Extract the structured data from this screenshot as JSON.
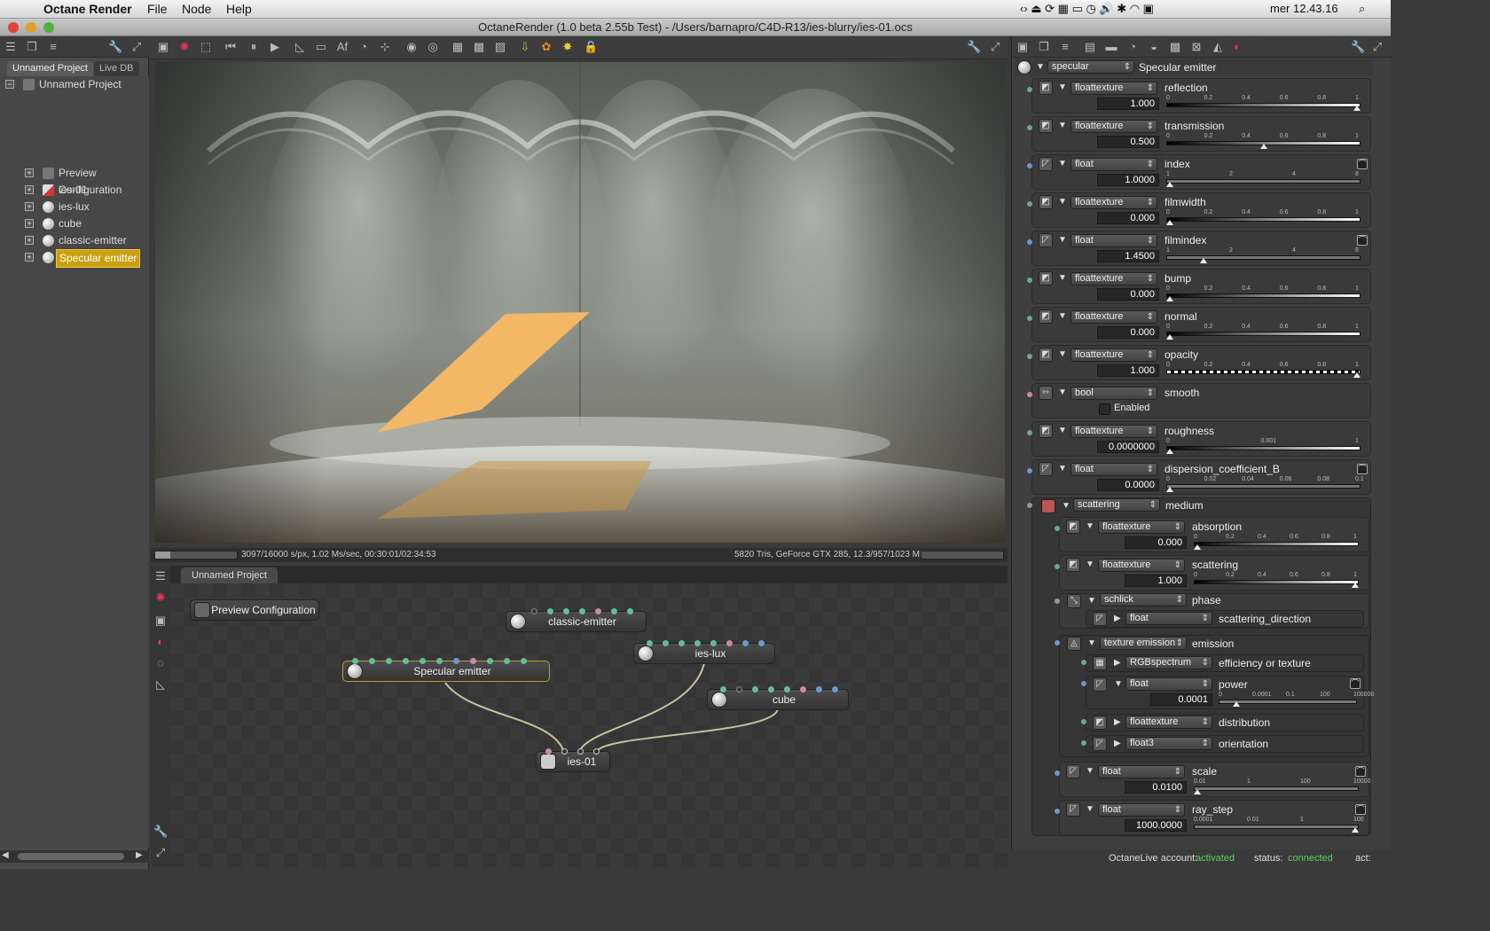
{
  "menubar": {
    "app": "Octane Render",
    "items": [
      "File",
      "Node",
      "Help"
    ],
    "clock": "mer 12.43.16"
  },
  "window": {
    "title": "OctaneRender (1.0 beta 2.55b Test) - /Users/barnapro/C4D-R13/ies-blurry/ies-01.ocs"
  },
  "left": {
    "tabs": [
      "Unnamed Project",
      "Live DB"
    ],
    "root": "Unnamed Project",
    "items": [
      "Preview Configuration",
      "ies-01",
      "ies-lux",
      "cube",
      "classic-emitter",
      "Specular emitter"
    ]
  },
  "viewport": {
    "status_left": "3097/16000 s/px, 1.02 Ms/sec, 00:30:01/02:34:53",
    "status_right": "5820 Tris, GeForce GTX 285, 12.3/957/1023 MB"
  },
  "nodeeditor": {
    "tab": "Unnamed Project",
    "preview": "Preview Configuration",
    "nodes": {
      "classic": "classic-emitter",
      "ieslux": "ies-lux",
      "specular": "Specular emitter",
      "cube": "cube",
      "ies01": "ies-01"
    }
  },
  "inspector": {
    "header_type": "specular",
    "header_name": "Specular emitter",
    "params": [
      {
        "type": "floattexture",
        "name": "reflection",
        "value": "1.000",
        "ticks": [
          "0",
          "0.2",
          "0.4",
          "0.6",
          "0.8",
          "1"
        ]
      },
      {
        "type": "floattexture",
        "name": "transmission",
        "value": "0.500",
        "ticks": [
          "0",
          "0.2",
          "0.4",
          "0.6",
          "0.8",
          "1"
        ]
      },
      {
        "type": "float",
        "name": "index",
        "value": "1.0000",
        "ticks": [
          "1",
          "2",
          "4",
          "8"
        ]
      },
      {
        "type": "floattexture",
        "name": "filmwidth",
        "value": "0.000",
        "ticks": [
          "0",
          "0.2",
          "0.4",
          "0.6",
          "0.8",
          "1"
        ]
      },
      {
        "type": "float",
        "name": "filmindex",
        "value": "1.4500",
        "ticks": [
          "1",
          "2",
          "4",
          "8"
        ]
      },
      {
        "type": "floattexture",
        "name": "bump",
        "value": "0.000",
        "ticks": [
          "0",
          "0.2",
          "0.4",
          "0.6",
          "0.8",
          "1"
        ]
      },
      {
        "type": "floattexture",
        "name": "normal",
        "value": "0.000",
        "ticks": [
          "0",
          "0.2",
          "0.4",
          "0.6",
          "0.8",
          "1"
        ]
      },
      {
        "type": "floattexture",
        "name": "opacity",
        "value": "1.000",
        "ticks": [
          "0",
          "0.2",
          "0.4",
          "0.6",
          "0.8",
          "1"
        ]
      },
      {
        "type": "bool",
        "name": "smooth",
        "value": "Enabled"
      },
      {
        "type": "floattexture",
        "name": "roughness",
        "value": "0.0000000",
        "ticks": [
          "0",
          "0.001",
          "1"
        ]
      },
      {
        "type": "float",
        "name": "dispersion_coefficient_B",
        "value": "0.0000",
        "ticks": [
          "0",
          "0.02",
          "0.04",
          "0.06",
          "0.08",
          "0.1"
        ]
      }
    ],
    "medium": {
      "type": "scattering",
      "name": "medium",
      "absorption": {
        "type": "floattexture",
        "name": "absorption",
        "value": "0.000",
        "ticks": [
          "0",
          "0.2",
          "0.4",
          "0.6",
          "0.8",
          "1"
        ]
      },
      "scattering": {
        "type": "floattexture",
        "name": "scattering",
        "value": "1.000",
        "ticks": [
          "0",
          "0.2",
          "0.4",
          "0.6",
          "0.8",
          "1"
        ]
      },
      "phase": {
        "type": "schlick",
        "name": "phase",
        "sub_type": "float",
        "sub_name": "scattering_direction"
      },
      "emission": {
        "type": "texture emission",
        "name": "emission",
        "eff_type": "RGBspectrum",
        "eff_name": "efficiency or texture",
        "power_type": "float",
        "power_name": "power",
        "power_value": "0.0001",
        "power_ticks": [
          "0",
          "0.0001",
          "0.1",
          "100",
          "100000"
        ],
        "dist_type": "floattexture",
        "dist_name": "distribution",
        "orient_type": "float3",
        "orient_name": "orientation"
      },
      "scale": {
        "type": "float",
        "name": "scale",
        "value": "0.0100",
        "ticks": [
          "0.01",
          "1",
          "100",
          "10000"
        ]
      },
      "ray_step": {
        "type": "float",
        "name": "ray_step",
        "value": "1000.0000",
        "ticks": [
          "0.0001",
          "0.01",
          "1",
          "100"
        ]
      }
    }
  },
  "footer": {
    "account_label": "OctaneLive account:",
    "account_value": "activated",
    "status_label": "status:",
    "status_value": "connected",
    "act_label": "act:"
  }
}
